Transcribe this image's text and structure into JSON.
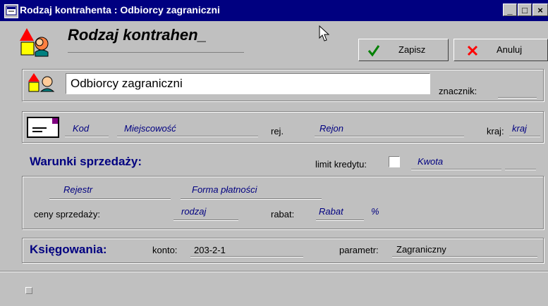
{
  "window": {
    "title": "Rodzaj kontrahenta : Odbiorcy zagraniczni",
    "controls": {
      "minimize": "_",
      "maximize": "□",
      "close": "×"
    }
  },
  "header": {
    "title": "Rodzaj kontrahen_",
    "save_label": "Zapisz",
    "cancel_label": "Anuluj",
    "colors": {
      "save_check": "#008000",
      "cancel_x": "#ff0000"
    }
  },
  "name_group": {
    "name_value": "Odbiorcy zagraniczni",
    "marker_label": "znacznik:"
  },
  "address_group": {
    "kod_placeholder": "Kod",
    "miejscowosc_placeholder": "Miejscowość",
    "rej_label": "rej.",
    "rejon_placeholder": "Rejon",
    "kraj_label": "kraj:",
    "kraj_placeholder": "kraj"
  },
  "sales": {
    "title": "Warunki sprzedaży:",
    "credit_limit_label": "limit kredytu:",
    "kwota_placeholder": "Kwota",
    "rejestr_placeholder": "Rejestr",
    "forma_platnosci_placeholder": "Forma płatności",
    "prices_label": "ceny sprzedaży:",
    "rodzaj_placeholder": "rodzaj",
    "rabat_label": "rabat:",
    "rabat_placeholder": "Rabat",
    "percent": "%"
  },
  "accounting": {
    "title": "Księgowania:",
    "konto_label": "konto:",
    "konto_value": "203-2-1",
    "parametr_label": "parametr:",
    "parametr_value": "Zagraniczny"
  },
  "icons": [
    "window-app-icon",
    "window-logo-icon",
    "people-icon",
    "envelope-icon",
    "checkmark-icon",
    "cancel-x-icon",
    "cursor-icon"
  ]
}
